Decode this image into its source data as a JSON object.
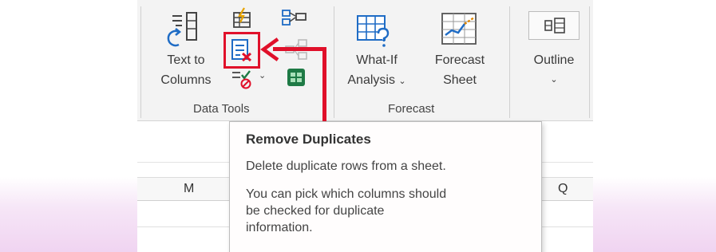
{
  "ribbon": {
    "text_to_columns": {
      "line1": "Text to",
      "line2": "Columns"
    },
    "what_if": {
      "line1": "What-If",
      "line2": "Analysis",
      "chevron": "⌄"
    },
    "forecast_sheet": {
      "line1": "Forecast",
      "line2": "Sheet"
    },
    "outline": {
      "label": "Outline",
      "chevron": "⌄"
    },
    "groups": {
      "data_tools": "Data Tools",
      "forecast": "Forecast"
    },
    "small_chevron": "⌄"
  },
  "columns": {
    "left": "M",
    "right": "Q"
  },
  "tooltip": {
    "title": "Remove Duplicates",
    "description": "Delete duplicate rows from a sheet.",
    "detail_lines": [
      "You can pick which columns should",
      "be checked for duplicate",
      "information."
    ]
  },
  "colors": {
    "accent_red": "#e0102a",
    "excel_green": "#1e7a45",
    "icon_blue": "#1f6cc5"
  },
  "icons": {
    "text_to_columns": "text-to-columns-icon",
    "flash_fill": "flash-fill-icon",
    "remove_duplicates": "remove-duplicates-icon",
    "data_validation": "data-validation-icon",
    "consolidate": "consolidate-icon",
    "relationships": "relationships-icon",
    "data_model": "data-model-icon",
    "what_if": "what-if-analysis-icon",
    "forecast_sheet": "forecast-sheet-icon",
    "outline": "outline-icon"
  }
}
